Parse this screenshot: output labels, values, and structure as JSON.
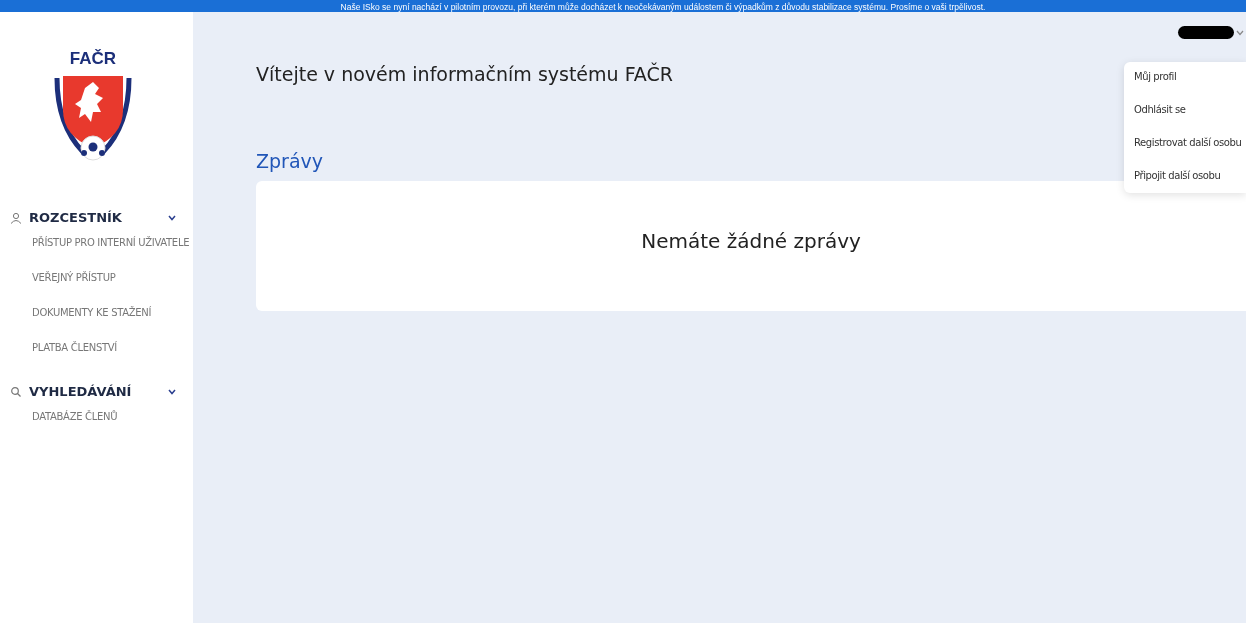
{
  "banner": {
    "text": "Naše ISko se nyní nachází v pilotním provozu, při kterém může docházet k neočekávaným událostem či výpadkům z důvodu stabilizace systému. Prosíme o vaši trpělivost."
  },
  "logo": {
    "text": "FAČR"
  },
  "sidebar": {
    "sections": [
      {
        "title": "ROZCESTNÍK",
        "expanded": true,
        "items": [
          "PŘÍSTUP PRO INTERNÍ UŽIVATELE",
          "VEŘEJNÝ PŘÍSTUP",
          "DOKUMENTY KE STAŽENÍ",
          "PLATBA ČLENSTVÍ"
        ]
      },
      {
        "title": "VYHLEDÁVÁNÍ",
        "expanded": true,
        "items": [
          "DATABÁZE ČLENŮ"
        ]
      }
    ]
  },
  "page_title": "Vítejte v novém informačním systému FAČR",
  "messages": {
    "heading": "Zprávy",
    "empty_text": "Nemáte žádné zprávy"
  },
  "user_menu": {
    "open": true,
    "items": [
      "Můj profil",
      "Odhlásit se",
      "Registrovat další osobu",
      "Připojit další osobu"
    ]
  }
}
